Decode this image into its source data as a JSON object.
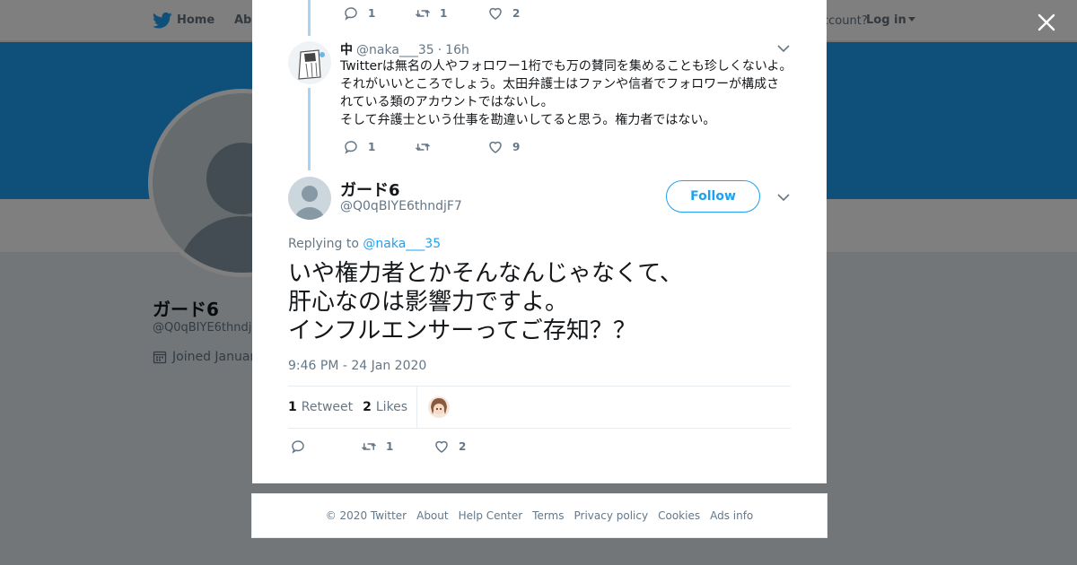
{
  "nav": {
    "home_label": "Home",
    "about_label": "Abo",
    "account_text": "ccount?",
    "login_label": "Log in"
  },
  "profile": {
    "name": "ガード6",
    "handle": "@Q0qBIYE6thndj",
    "joined": "Joined Januar",
    "banner_color": "#1da1f2"
  },
  "prev_tweet": {
    "reply_count": "1",
    "retweet_count": "1",
    "like_count": "2"
  },
  "reply_tweet": {
    "name": "中",
    "handle": "@naka___35",
    "separator": "·",
    "time": "16h",
    "text": "Twitterは無名の人やフォロワー1桁でも万の賛同を集めることも珍しくないよ。\nそれがいいところでしょう。太田弁護士はファンや信者でフォロワーが構成さ\nれている類のアカウントではないし。\nそして弁護士という仕事を勘違いしてると思う。権力者ではない。",
    "reply_count": "1",
    "retweet_count": "",
    "like_count": "9"
  },
  "main_tweet": {
    "name": "ガード6",
    "handle": "@Q0qBIYE6thndjF7",
    "follow_label": "Follow",
    "replying_prefix": "Replying to",
    "replying_to": "@naka___35",
    "text": "いや権力者とかそんなんじゃなくて、\n肝心なのは影響力ですよ。\nインフルエンサーってご存知？？",
    "timestamp": "9:46 PM - 24 Jan 2020",
    "retweets_num": "1",
    "retweets_label": "Retweet",
    "likes_num": "2",
    "likes_label": "Likes",
    "reply_count": "",
    "retweet_count": "1",
    "like_count": "2"
  },
  "footer": {
    "links": [
      "© 2020 Twitter",
      "About",
      "Help Center",
      "Terms",
      "Privacy policy",
      "Cookies",
      "Ads info"
    ]
  },
  "colors": {
    "accent": "#1da1f2",
    "thread_line": "#a6d4f2",
    "muted": "#657786"
  }
}
